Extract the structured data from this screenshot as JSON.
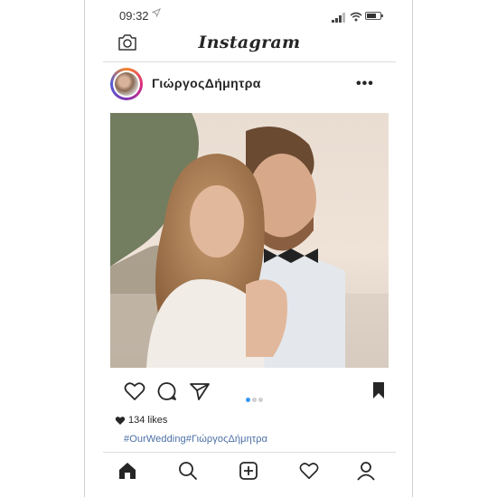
{
  "status_bar": {
    "time": "09:32",
    "location_icon": "location-arrow-icon",
    "signal_icon": "signal-bars-icon",
    "wifi_icon": "wifi-icon",
    "battery_icon": "battery-icon",
    "battery_level": 0.7
  },
  "top_bar": {
    "logo": "Instagram",
    "camera_icon": "camera-icon"
  },
  "post": {
    "username": "ΓιώργοςΔήμητρα",
    "more_icon": "more-options-icon",
    "actions": {
      "like_icon": "heart-icon",
      "comment_icon": "comment-icon",
      "share_icon": "send-icon",
      "save_icon": "bookmark-icon"
    },
    "carousel": {
      "count": 3,
      "active_index": 0,
      "active_color": "#3897f0"
    },
    "likes": "134 likes",
    "caption": "#OurWedding#ΓιώργοςΔήμητρα"
  },
  "bottom_nav": [
    "home-icon",
    "search-icon",
    "new-post-icon",
    "activity-heart-icon",
    "profile-icon"
  ],
  "colors": {
    "text": "#262626",
    "hashtag": "#4a6fa5",
    "divider": "#dcdcdc"
  }
}
